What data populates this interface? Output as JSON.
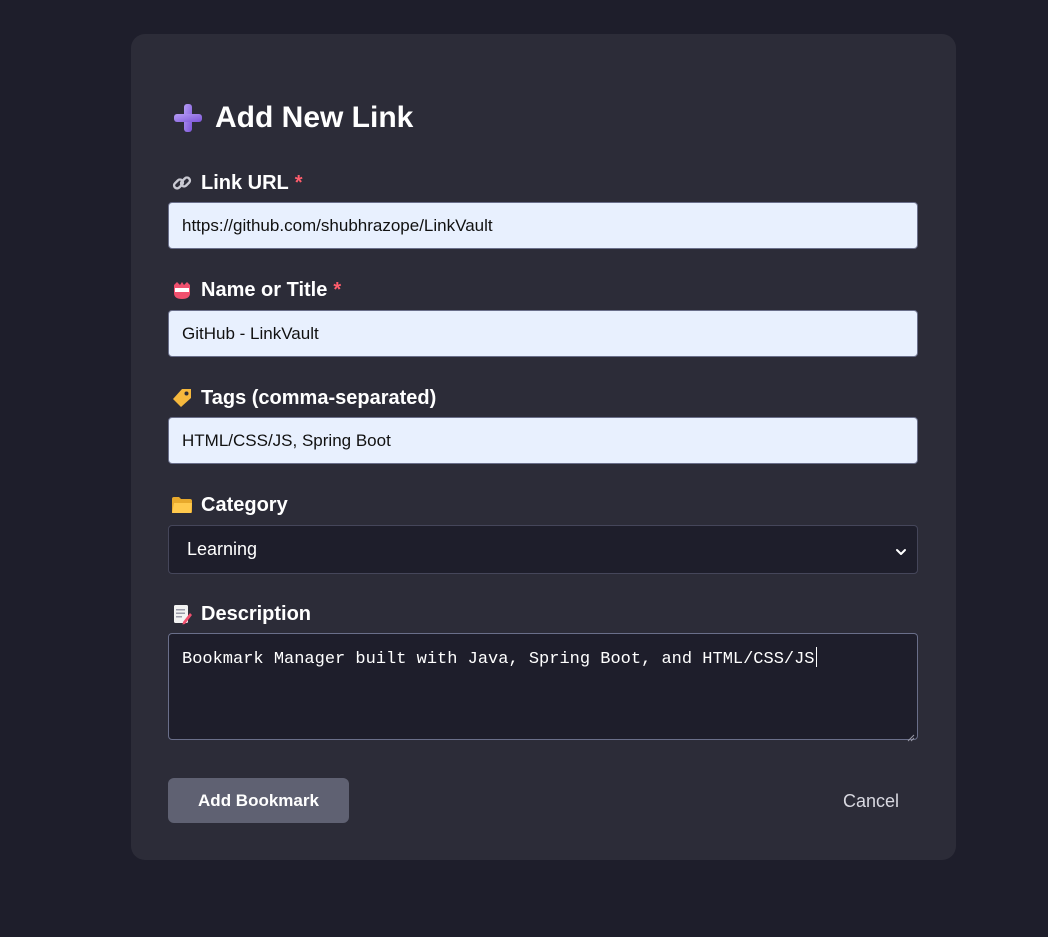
{
  "form": {
    "title": "Add New Link",
    "title_icon": "plus-icon",
    "fields": {
      "url": {
        "label": "Link URL",
        "required_mark": "*",
        "icon": "link-icon",
        "value": "https://github.com/shubhrazope/LinkVault"
      },
      "name": {
        "label": "Name or Title",
        "required_mark": "*",
        "icon": "name-badge-icon",
        "value": "GitHub - LinkVault"
      },
      "tags": {
        "label": "Tags (comma-separated)",
        "icon": "tag-icon",
        "value": "HTML/CSS/JS, Spring Boot"
      },
      "category": {
        "label": "Category",
        "icon": "folder-icon",
        "selected": "Learning"
      },
      "description": {
        "label": "Description",
        "icon": "memo-icon",
        "value": "Bookmark Manager built with Java, Spring Boot, and HTML/CSS/JS"
      }
    },
    "buttons": {
      "submit": "Add Bookmark",
      "cancel": "Cancel"
    }
  },
  "colors": {
    "page_background": "#1e1e2b",
    "card_background": "#2c2c38",
    "input_background": "#e8f0fe",
    "required_accent": "#ff5d6c",
    "primary_button": "#5f6172"
  }
}
